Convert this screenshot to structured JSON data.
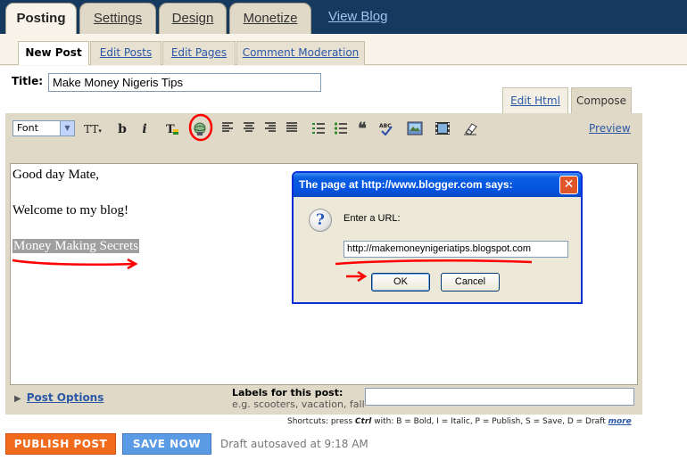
{
  "top_tabs": [
    {
      "label": "Posting",
      "active": true
    },
    {
      "label": "Settings",
      "active": false
    },
    {
      "label": "Design",
      "active": false
    },
    {
      "label": "Monetize",
      "active": false
    }
  ],
  "view_blog": "View Blog",
  "sub_tabs": [
    {
      "label": "New Post",
      "active": true
    },
    {
      "label": "Edit Posts",
      "active": false
    },
    {
      "label": "Edit Pages",
      "active": false
    },
    {
      "label": "Comment Moderation",
      "active": false
    }
  ],
  "title_label": "Title:",
  "title_value": "Make Money Nigeris Tips",
  "mode_tabs": {
    "edit_html": "Edit Html",
    "compose": "Compose"
  },
  "toolbar": {
    "font_select": "Font",
    "font_size_glyph": "TT",
    "bold": "b",
    "italic": "i",
    "text_color_glyph": "T",
    "preview": "Preview"
  },
  "editor_content": {
    "line1": "Good day Mate,",
    "line2": "Welcome to my blog!",
    "line3_selected": "Money Making Secrets"
  },
  "post_options": "Post Options",
  "labels": {
    "label": "Labels for this post:",
    "hint": "e.g. scooters, vacation, fall"
  },
  "shortcuts": {
    "prefix": "Shortcuts: press",
    "key": "Ctrl",
    "text": "with: B = Bold, I = Italic, P = Publish, S = Save, D = Draft",
    "more": "more"
  },
  "buttons": {
    "publish": "PUBLISH POST",
    "save": "SAVE NOW"
  },
  "autosave_status": "Draft autosaved at 9:18 AM",
  "dialog": {
    "title": "The page at http://www.blogger.com says:",
    "prompt": "Enter a URL:",
    "url_value": "http://makemoneynigeriatips.blogspot.com",
    "ok": "OK",
    "cancel": "Cancel",
    "close_glyph": "✕",
    "icon_glyph": "?"
  },
  "colors": {
    "header_navy": "#16395f",
    "tab_beige": "#e1d9c8",
    "link_blue": "#2b58a6",
    "publish_orange": "#f26b1d",
    "save_blue": "#5b9be5",
    "annotation_red": "#ff0000",
    "xp_title_blue": "#0553e0"
  },
  "icons": [
    "font-size-icon",
    "bold-icon",
    "italic-icon",
    "text-color-icon",
    "link-icon",
    "align-left-icon",
    "align-center-icon",
    "align-right-icon",
    "justify-icon",
    "numbered-list-icon",
    "bullet-list-icon",
    "blockquote-icon",
    "spellcheck-icon",
    "image-icon",
    "video-icon",
    "remove-formatting-icon"
  ]
}
